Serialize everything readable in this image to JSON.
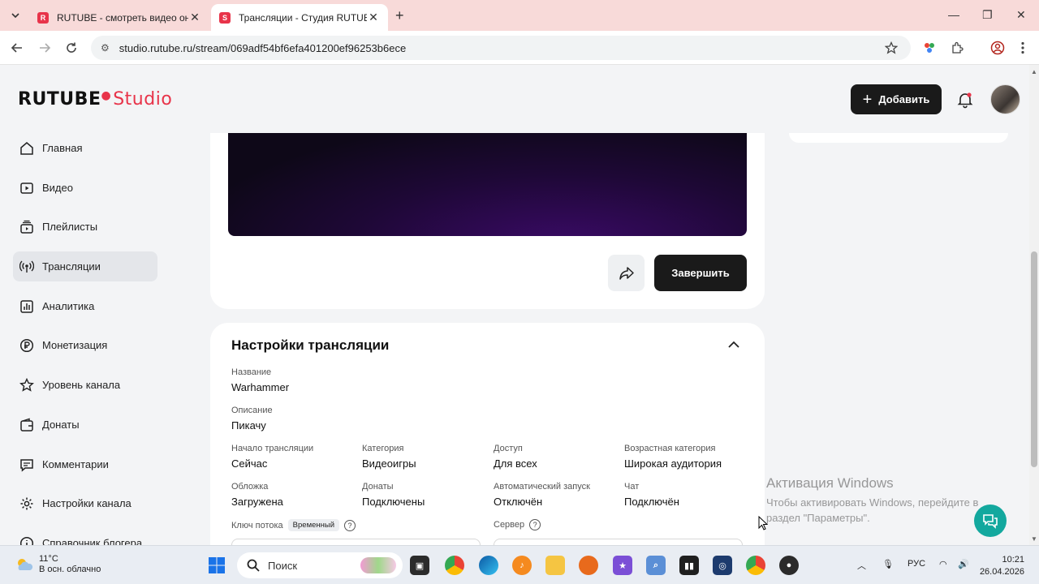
{
  "browser": {
    "tabs": [
      {
        "title": "RUTUBE - смотреть видео онл",
        "fav_color": "#e8344a",
        "fav_letter": "R"
      },
      {
        "title": "Трансляции - Студия RUTUBE",
        "fav_color": "#e8344a",
        "fav_letter": "S"
      }
    ],
    "url": "studio.rutube.ru/stream/069adf54bf6efa401200ef96253b6ece"
  },
  "header": {
    "logo_main": "RUTUBE",
    "logo_studio": "Studio",
    "add_label": "Добавить"
  },
  "sidebar": {
    "items": [
      {
        "label": "Главная",
        "icon": "home-icon"
      },
      {
        "label": "Видео",
        "icon": "video-icon"
      },
      {
        "label": "Плейлисты",
        "icon": "playlist-icon"
      },
      {
        "label": "Трансляции",
        "icon": "broadcast-icon",
        "active": true
      },
      {
        "label": "Аналитика",
        "icon": "analytics-icon"
      },
      {
        "label": "Монетизация",
        "icon": "ruble-icon"
      },
      {
        "label": "Уровень канала",
        "icon": "star-icon"
      },
      {
        "label": "Донаты",
        "icon": "wallet-icon"
      },
      {
        "label": "Комментарии",
        "icon": "comment-icon"
      },
      {
        "label": "Настройки канала",
        "icon": "gear-icon"
      },
      {
        "label": "Справочник блогера",
        "icon": "info-icon"
      }
    ]
  },
  "stream": {
    "finish_label": "Завершить"
  },
  "settings": {
    "title": "Настройки трансляции",
    "name_label": "Название",
    "name_value": "Warhammer",
    "desc_label": "Описание",
    "desc_value": "Пикачу",
    "fields": [
      {
        "label": "Начало трансляции",
        "value": "Сейчас"
      },
      {
        "label": "Категория",
        "value": "Видеоигры"
      },
      {
        "label": "Доступ",
        "value": "Для всех"
      },
      {
        "label": "Возрастная категория",
        "value": "Широкая аудитория"
      },
      {
        "label": "Обложка",
        "value": "Загружена"
      },
      {
        "label": "Донаты",
        "value": "Подключены"
      },
      {
        "label": "Автоматический запуск",
        "value": "Отключён"
      },
      {
        "label": "Чат",
        "value": "Подключён"
      }
    ],
    "key_label": "Ключ потока",
    "key_badge": "Временный",
    "server_label": "Сервер"
  },
  "activation": {
    "title": "Активация Windows",
    "line1": "Чтобы активировать Windows, перейдите в",
    "line2": "раздел \"Параметры\"."
  },
  "taskbar": {
    "temp": "11°C",
    "weather": "В осн. облачно",
    "search_placeholder": "Поиск",
    "lang": "РУС",
    "time": "10:21",
    "date": "26.04.2026"
  }
}
